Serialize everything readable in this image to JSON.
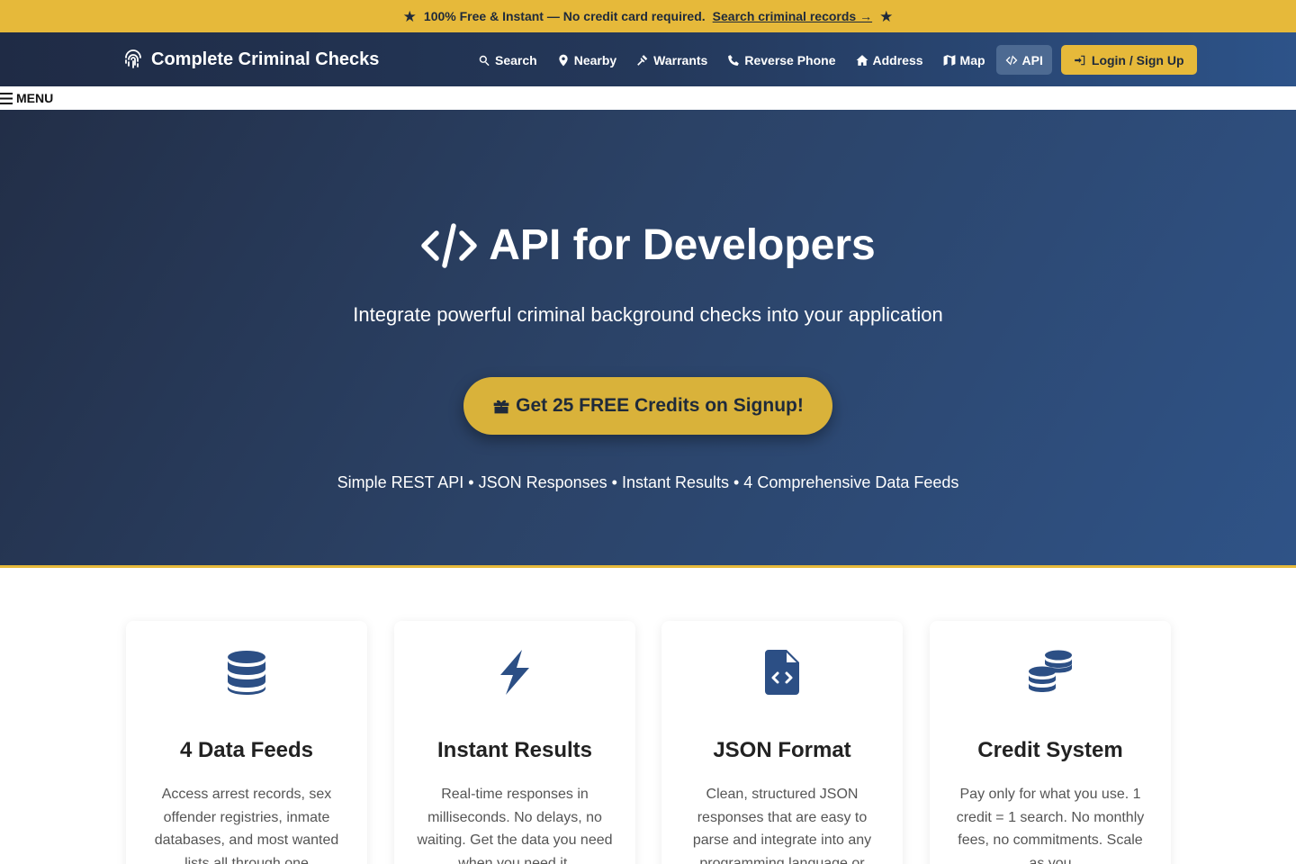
{
  "announcement": {
    "text": "100% Free & Instant — No credit card required.",
    "link": "Search criminal records →"
  },
  "brand": {
    "name": "Complete Criminal Checks",
    "icon": "fingerprint-icon"
  },
  "nav": {
    "items": [
      {
        "label": "Search",
        "icon": "search-icon"
      },
      {
        "label": "Nearby",
        "icon": "map-pin-icon"
      },
      {
        "label": "Warrants",
        "icon": "gavel-icon"
      },
      {
        "label": "Reverse Phone",
        "icon": "phone-icon"
      },
      {
        "label": "Address",
        "icon": "home-icon"
      },
      {
        "label": "Map",
        "icon": "map-icon"
      },
      {
        "label": "API",
        "icon": "code-icon",
        "active": true
      }
    ],
    "login_label": "Login / Sign Up"
  },
  "menu_label": "MENU",
  "hero": {
    "title": "API for Developers",
    "subtitle": "Integrate powerful criminal background checks into your application",
    "cta": "Get 25 FREE Credits on Signup!",
    "features": "Simple REST API • JSON Responses • Instant Results • 4 Comprehensive Data Feeds"
  },
  "cards": [
    {
      "icon": "database-icon",
      "title": "4 Data Feeds",
      "text": "Access arrest records, sex offender registries, inmate databases, and most wanted lists all through one"
    },
    {
      "icon": "bolt-icon",
      "title": "Instant Results",
      "text": "Real-time responses in milliseconds. No delays, no waiting. Get the data you need when you need it."
    },
    {
      "icon": "file-code-icon",
      "title": "JSON Format",
      "text": "Clean, structured JSON responses that are easy to parse and integrate into any programming language or"
    },
    {
      "icon": "coins-icon",
      "title": "Credit System",
      "text": "Pay only for what you use. 1 credit = 1 search. No monthly fees, no commitments. Scale as you"
    }
  ],
  "colors": {
    "accent": "#e6b93a",
    "navy": "#1f2b45",
    "blue": "#2c4f85"
  }
}
